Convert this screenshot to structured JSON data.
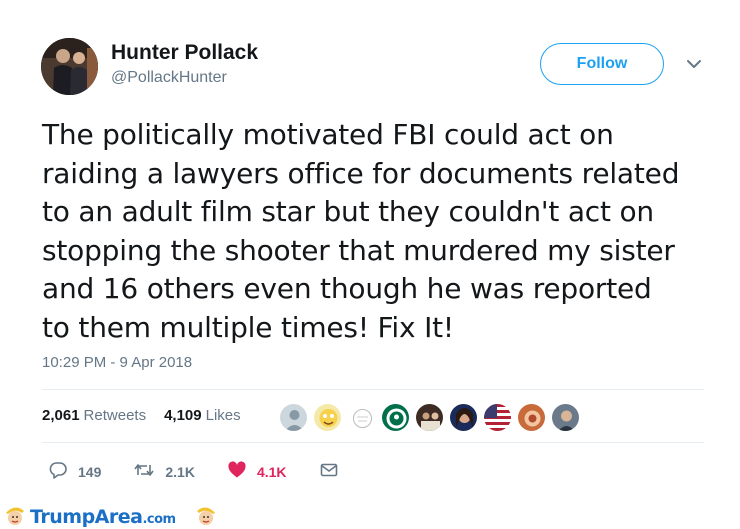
{
  "author": {
    "name": "Hunter Pollack",
    "handle": "@PollackHunter"
  },
  "follow_label": "Follow",
  "tweet": {
    "lines": [
      "The politically motivated FBI could act on",
      "raiding a lawyers office for documents related",
      "to an adult film star but they couldn't act on",
      "stopping the shooter that murdered my sister",
      "and 16 others even though he was reported",
      "to them multiple times! Fix It!"
    ],
    "timestamp": "10:29 PM - 9 Apr 2018"
  },
  "stats": {
    "retweets_count": "2,061",
    "retweets_label": "Retweets",
    "likes_count": "4,109",
    "likes_label": "Likes"
  },
  "likers": [
    "default-avatar",
    "cartoon-avatar",
    "sketch-avatar",
    "starbucks-avatar",
    "group-avatar",
    "woman-avatar",
    "flag-avatar",
    "pattern-avatar",
    "man-avatar"
  ],
  "actions": {
    "replies": "149",
    "retweets": "2.1K",
    "likes": "4.1K"
  },
  "footer": {
    "brand_trump": "Trump",
    "brand_area": "Area",
    "brand_com": ".com"
  },
  "colors": {
    "accent": "#1da1f2",
    "like": "#e0245e",
    "secondary_text": "#657786"
  }
}
